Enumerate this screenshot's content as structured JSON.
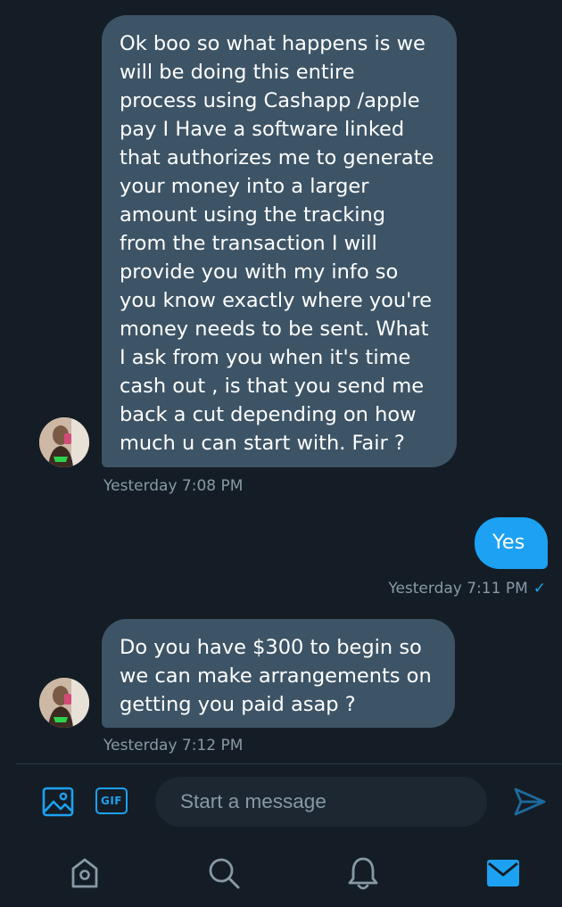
{
  "messages": [
    {
      "direction": "incoming",
      "text": "Ok boo so what happens is we will be doing this entire process using  Cashapp /apple pay I Have a software linked that authorizes me to generate your money into a larger amount using the tracking from the transaction I will provide you with my  info so you know exactly where you're money needs to be sent. What I ask from you when it's time cash out , is that you send me back a cut depending on how much u can start with. Fair ?",
      "timestamp": "Yesterday 7:08 PM"
    },
    {
      "direction": "outgoing",
      "text": "Yes",
      "timestamp": "Yesterday 7:11 PM",
      "read_mark": "✓"
    },
    {
      "direction": "incoming",
      "text": "Do you have $300 to begin so we can make arrangements on getting you paid asap ?",
      "timestamp": "Yesterday 7:12 PM"
    }
  ],
  "composer": {
    "placeholder": "Start a message",
    "gif_label": "GIF",
    "image_icon": "image-icon",
    "send_icon": "send-icon"
  },
  "tabbar": {
    "items": [
      "home-icon",
      "search-icon",
      "notifications-icon",
      "messages-icon"
    ],
    "active": "messages-icon"
  },
  "colors": {
    "background": "#141d26",
    "incoming_bubble": "#3d5466",
    "outgoing_bubble": "#1da1f2",
    "accent": "#1da1f2",
    "muted_text": "#8899a6",
    "icon_inactive": "#8899a6"
  }
}
